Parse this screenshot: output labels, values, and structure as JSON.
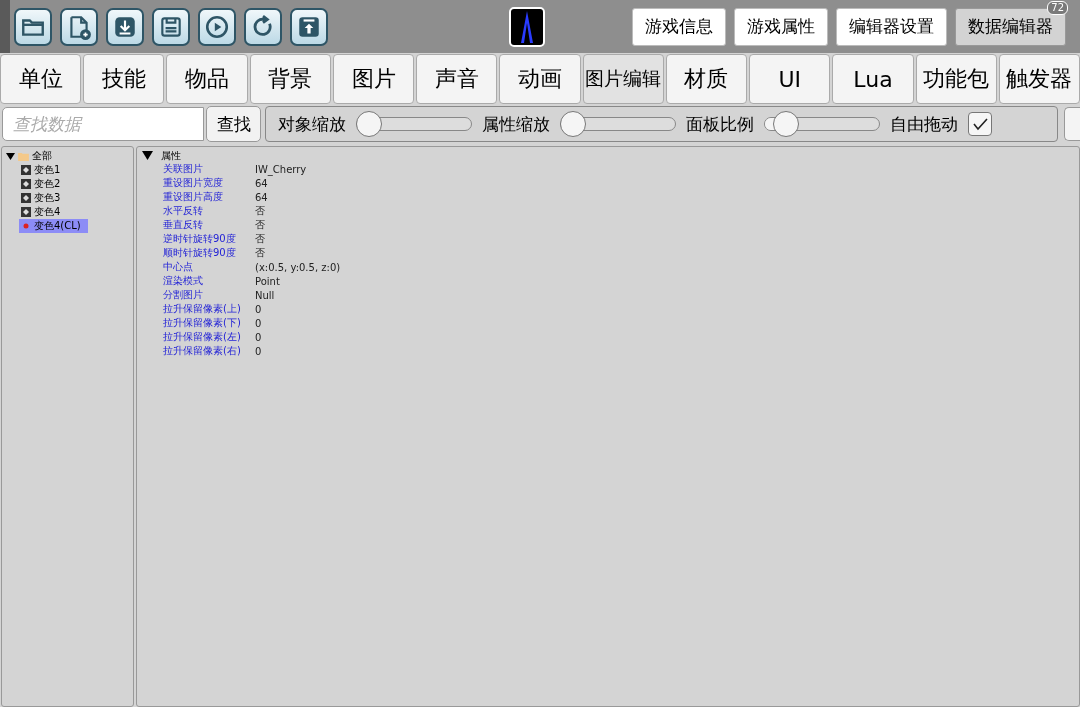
{
  "toolbar": {
    "tools": [
      {
        "kind": "folder"
      },
      {
        "kind": "new-file"
      },
      {
        "kind": "download"
      },
      {
        "kind": "save"
      },
      {
        "kind": "play"
      },
      {
        "kind": "refresh"
      },
      {
        "kind": "upload"
      }
    ],
    "header_buttons": [
      {
        "label": "游戏信息",
        "selected": false
      },
      {
        "label": "游戏属性",
        "selected": false
      },
      {
        "label": "编辑器设置",
        "selected": false
      },
      {
        "label": "数据编辑器",
        "selected": true
      }
    ],
    "badge": "72"
  },
  "tabs": [
    {
      "label": "单位",
      "selected": false
    },
    {
      "label": "技能",
      "selected": false
    },
    {
      "label": "物品",
      "selected": false
    },
    {
      "label": "背景",
      "selected": false
    },
    {
      "label": "图片",
      "selected": false
    },
    {
      "label": "声音",
      "selected": false
    },
    {
      "label": "动画",
      "selected": false
    },
    {
      "label": "图片编辑",
      "selected": true
    },
    {
      "label": "材质",
      "selected": false
    },
    {
      "label": "UI",
      "selected": false
    },
    {
      "label": "Lua",
      "selected": false
    },
    {
      "label": "功能包",
      "selected": false
    },
    {
      "label": "触发器",
      "selected": false
    }
  ],
  "search": {
    "placeholder": "查找数据",
    "button": "查找"
  },
  "sliders": [
    {
      "label": "对象缩放",
      "level": 0.0
    },
    {
      "label": "属性缩放",
      "level": 0.0
    },
    {
      "label": "面板比例",
      "level": 0.1
    }
  ],
  "free_drag": {
    "label": "自由拖动",
    "checked": true
  },
  "tree": {
    "label": "全部",
    "expanded": true,
    "children": [
      {
        "label": "变色1",
        "kind": "unit",
        "selected": false
      },
      {
        "label": "变色2",
        "kind": "unit",
        "selected": false
      },
      {
        "label": "变色3",
        "kind": "unit",
        "selected": false
      },
      {
        "label": "变色4",
        "kind": "unit",
        "selected": false
      },
      {
        "label": "变色4(CL)",
        "kind": "dot",
        "selected": true
      }
    ]
  },
  "properties": {
    "title": "属性",
    "expanded": true,
    "rows": [
      {
        "name": "关联图片",
        "value": "IW_Cherry"
      },
      {
        "name": "重设图片宽度",
        "value": "64"
      },
      {
        "name": "重设图片高度",
        "value": "64"
      },
      {
        "name": "水平反转",
        "value": "否"
      },
      {
        "name": "垂直反转",
        "value": "否"
      },
      {
        "name": "逆时针旋转90度",
        "value": "否"
      },
      {
        "name": "顺时针旋转90度",
        "value": "否"
      },
      {
        "name": "中心点",
        "value": "(x:0.5, y:0.5, z:0)"
      },
      {
        "name": "渲染模式",
        "value": "Point"
      },
      {
        "name": "分割图片",
        "value": "Null"
      },
      {
        "name": "拉升保留像素(上)",
        "value": "0"
      },
      {
        "name": "拉升保留像素(下)",
        "value": "0"
      },
      {
        "name": "拉升保留像素(左)",
        "value": "0"
      },
      {
        "name": "拉升保留像素(右)",
        "value": "0"
      }
    ]
  }
}
